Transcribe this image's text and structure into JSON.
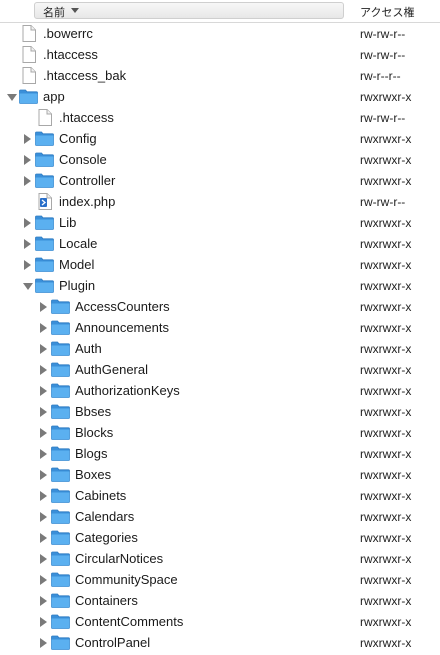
{
  "columns": {
    "name": "名前",
    "permissions": "アクセス権"
  },
  "rows": [
    {
      "name": ".bowerrc",
      "perm": "rw-rw-r--",
      "type": "file",
      "indent": 0
    },
    {
      "name": ".htaccess",
      "perm": "rw-rw-r--",
      "type": "file",
      "indent": 0
    },
    {
      "name": ".htaccess_bak",
      "perm": "rw-r--r--",
      "type": "file",
      "indent": 0
    },
    {
      "name": "app",
      "perm": "rwxrwxr-x",
      "type": "folder",
      "expanded": true,
      "indent": 0
    },
    {
      "name": ".htaccess",
      "perm": "rw-rw-r--",
      "type": "file",
      "indent": 1
    },
    {
      "name": "Config",
      "perm": "rwxrwxr-x",
      "type": "folder",
      "expanded": false,
      "indent": 1
    },
    {
      "name": "Console",
      "perm": "rwxrwxr-x",
      "type": "folder",
      "expanded": false,
      "indent": 1
    },
    {
      "name": "Controller",
      "perm": "rwxrwxr-x",
      "type": "folder",
      "expanded": false,
      "indent": 1
    },
    {
      "name": "index.php",
      "perm": "rw-rw-r--",
      "type": "php",
      "indent": 1
    },
    {
      "name": "Lib",
      "perm": "rwxrwxr-x",
      "type": "folder",
      "expanded": false,
      "indent": 1
    },
    {
      "name": "Locale",
      "perm": "rwxrwxr-x",
      "type": "folder",
      "expanded": false,
      "indent": 1
    },
    {
      "name": "Model",
      "perm": "rwxrwxr-x",
      "type": "folder",
      "expanded": false,
      "indent": 1
    },
    {
      "name": "Plugin",
      "perm": "rwxrwxr-x",
      "type": "folder",
      "expanded": true,
      "indent": 1
    },
    {
      "name": "AccessCounters",
      "perm": "rwxrwxr-x",
      "type": "folder",
      "expanded": false,
      "indent": 2
    },
    {
      "name": "Announcements",
      "perm": "rwxrwxr-x",
      "type": "folder",
      "expanded": false,
      "indent": 2
    },
    {
      "name": "Auth",
      "perm": "rwxrwxr-x",
      "type": "folder",
      "expanded": false,
      "indent": 2
    },
    {
      "name": "AuthGeneral",
      "perm": "rwxrwxr-x",
      "type": "folder",
      "expanded": false,
      "indent": 2
    },
    {
      "name": "AuthorizationKeys",
      "perm": "rwxrwxr-x",
      "type": "folder",
      "expanded": false,
      "indent": 2
    },
    {
      "name": "Bbses",
      "perm": "rwxrwxr-x",
      "type": "folder",
      "expanded": false,
      "indent": 2
    },
    {
      "name": "Blocks",
      "perm": "rwxrwxr-x",
      "type": "folder",
      "expanded": false,
      "indent": 2
    },
    {
      "name": "Blogs",
      "perm": "rwxrwxr-x",
      "type": "folder",
      "expanded": false,
      "indent": 2
    },
    {
      "name": "Boxes",
      "perm": "rwxrwxr-x",
      "type": "folder",
      "expanded": false,
      "indent": 2
    },
    {
      "name": "Cabinets",
      "perm": "rwxrwxr-x",
      "type": "folder",
      "expanded": false,
      "indent": 2
    },
    {
      "name": "Calendars",
      "perm": "rwxrwxr-x",
      "type": "folder",
      "expanded": false,
      "indent": 2
    },
    {
      "name": "Categories",
      "perm": "rwxrwxr-x",
      "type": "folder",
      "expanded": false,
      "indent": 2
    },
    {
      "name": "CircularNotices",
      "perm": "rwxrwxr-x",
      "type": "folder",
      "expanded": false,
      "indent": 2
    },
    {
      "name": "CommunitySpace",
      "perm": "rwxrwxr-x",
      "type": "folder",
      "expanded": false,
      "indent": 2
    },
    {
      "name": "Containers",
      "perm": "rwxrwxr-x",
      "type": "folder",
      "expanded": false,
      "indent": 2
    },
    {
      "name": "ContentComments",
      "perm": "rwxrwxr-x",
      "type": "folder",
      "expanded": false,
      "indent": 2
    },
    {
      "name": "ControlPanel",
      "perm": "rwxrwxr-x",
      "type": "folder",
      "expanded": false,
      "indent": 2
    }
  ]
}
